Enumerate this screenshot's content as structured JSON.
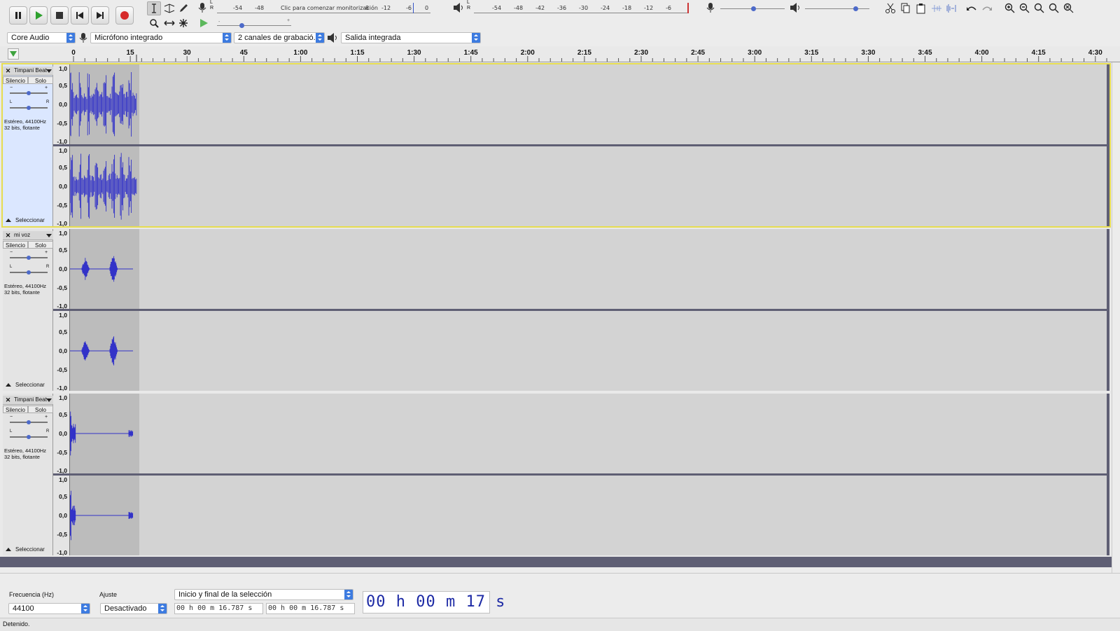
{
  "meters": {
    "rec_scale": [
      "-54",
      "-48",
      "Clic para comenzar monitorización",
      "8",
      "-12",
      "-6",
      "0"
    ],
    "play_scale": [
      "-54",
      "-48",
      "-42",
      "-36",
      "-30",
      "-24",
      "-18",
      "-12",
      "-6"
    ]
  },
  "device": {
    "host": "Core Audio",
    "input": "Micrófono integrado",
    "channels": "2 canales de grabació...",
    "output": "Salida integrada"
  },
  "ruler": {
    "labels": [
      "0",
      "15",
      "30",
      "45",
      "1:00",
      "1:15",
      "1:30",
      "1:45",
      "2:00",
      "2:15",
      "2:30",
      "2:45",
      "3:00",
      "3:15",
      "3:30",
      "3:45",
      "4:00",
      "4:15",
      "4:30"
    ]
  },
  "scale_labels": [
    "1,0",
    "0,5",
    "0,0",
    "-0,5",
    "-1,0"
  ],
  "tracks": [
    {
      "name": "Timpani Beat",
      "mute": "Silencio",
      "solo": "Solo",
      "info_line1": "Estéreo, 44100Hz",
      "info_line2": "32 bits, flotante",
      "select": "Seleccionar",
      "gain_fraction": 0.5,
      "pan_fraction": 0.5
    },
    {
      "name": "mi voz",
      "mute": "Silencio",
      "solo": "Solo",
      "info_line1": "Estéreo, 44100Hz",
      "info_line2": "32 bits, flotante",
      "select": "Seleccionar",
      "gain_fraction": 0.5,
      "pan_fraction": 0.5
    },
    {
      "name": "Timpani Beat",
      "mute": "Silencio",
      "solo": "Solo",
      "info_line1": "Estéreo, 44100Hz",
      "info_line2": "32 bits, flotante",
      "select": "Seleccionar",
      "gain_fraction": 0.5,
      "pan_fraction": 0.5
    }
  ],
  "selection_toolbar": {
    "rate_label": "Frecuencia (Hz)",
    "rate_value": "44100",
    "snap_label": "Ajuste",
    "snap_value": "Desactivado",
    "mode_value": "Inicio y final de la selección",
    "start_time": "00 h 00 m 16.787 s",
    "end_time": "00 h 00 m 16.787 s"
  },
  "time_display": "00 h 00 m 17 s",
  "status": "Detenido.",
  "colors": {
    "waveform": "#3232c8",
    "record": "#d62b2b",
    "play": "#2ea12e",
    "track_selected": "#dbe7ff",
    "selection_border": "#e6dc50"
  }
}
